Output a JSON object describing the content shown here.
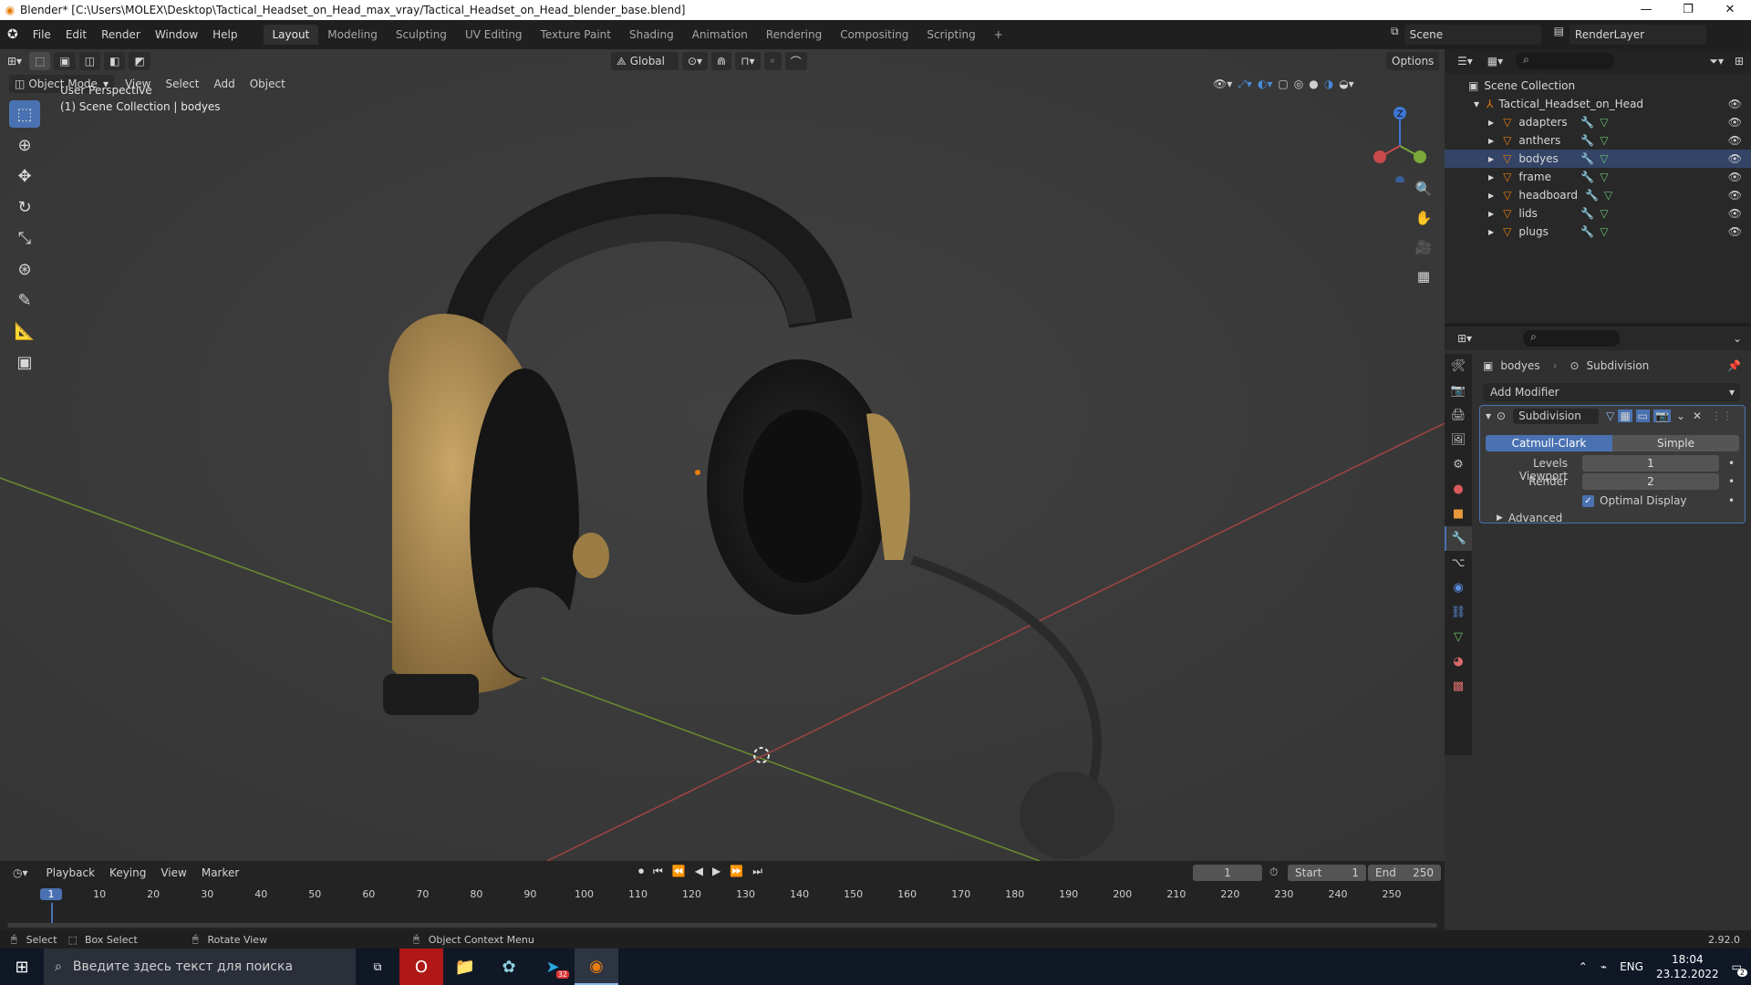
{
  "window": {
    "title": "Blender* [C:\\Users\\MOLEX\\Desktop\\Tactical_Headset_on_Head_max_vray/Tactical_Headset_on_Head_blender_base.blend]",
    "controls": [
      "—",
      "❐",
      "✕"
    ]
  },
  "menu": [
    "File",
    "Edit",
    "Render",
    "Window",
    "Help"
  ],
  "workspaces": [
    "Layout",
    "Modeling",
    "Sculpting",
    "UV Editing",
    "Texture Paint",
    "Shading",
    "Animation",
    "Rendering",
    "Compositing",
    "Scripting",
    "+"
  ],
  "active_workspace": "Layout",
  "scene": {
    "name": "Scene",
    "view_layer": "RenderLayer"
  },
  "viewport": {
    "mode": "Object Mode",
    "menus": [
      "View",
      "Select",
      "Add",
      "Object"
    ],
    "transform_orientation": "Global",
    "options_label": "Options",
    "overlay_text_1": "User Perspective",
    "overlay_text_2": "(1) Scene Collection | bodyes",
    "gizmo_labels": {
      "z": "Z",
      "x": "X",
      "y": "Y"
    }
  },
  "outliner": {
    "root": "Scene Collection",
    "collection": "Tactical_Headset_on_Head",
    "objects": [
      "adapters",
      "anthers",
      "bodyes",
      "frame",
      "headboard",
      "lids",
      "plugs"
    ]
  },
  "properties": {
    "object_name": "bodyes",
    "modifier_context": "Subdivision",
    "add_modifier": "Add Modifier",
    "modifier": {
      "name": "Subdivision",
      "type_options": [
        "Catmull-Clark",
        "Simple"
      ],
      "type_selected": "Catmull-Clark",
      "levels_viewport_label": "Levels Viewport",
      "levels_viewport": "1",
      "render_label": "Render",
      "render": "2",
      "optimal_display_label": "Optimal Display",
      "optimal_display": true,
      "advanced_label": "Advanced"
    }
  },
  "timeline": {
    "menus": [
      "Playback",
      "Keying",
      "View",
      "Marker"
    ],
    "current_frame": "1",
    "start_label": "Start",
    "start": "1",
    "end_label": "End",
    "end": "250",
    "ticks": [
      "1",
      "10",
      "20",
      "30",
      "40",
      "50",
      "60",
      "70",
      "80",
      "90",
      "100",
      "110",
      "120",
      "130",
      "140",
      "150",
      "160",
      "170",
      "180",
      "190",
      "200",
      "210",
      "220",
      "230",
      "240",
      "250"
    ]
  },
  "status_bar": {
    "select": "Select",
    "box_select": "Box Select",
    "rotate_view": "Rotate View",
    "context_menu": "Object Context Menu",
    "version": "2.92.0"
  },
  "taskbar": {
    "search_placeholder": "Введите здесь текст для поиска",
    "language": "ENG",
    "time": "18:04",
    "date": "23.12.2022",
    "telegram_badge": "32",
    "notification_count": "2"
  },
  "colors": {
    "accent": "#4a72b2",
    "object_orange": "#e87d0d",
    "x_axis": "#c94b4b",
    "y_axis": "#7aa83a",
    "z_axis": "#3e78d6"
  }
}
